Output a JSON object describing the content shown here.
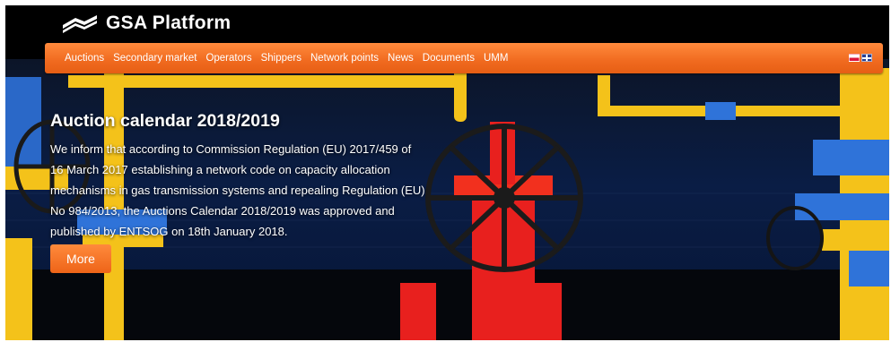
{
  "header": {
    "brand": "GSA Platform"
  },
  "nav": {
    "items": [
      "Auctions",
      "Secondary market",
      "Operators",
      "Shippers",
      "Network points",
      "News",
      "Documents",
      "UMM"
    ]
  },
  "languages": [
    "pl-flag-icon",
    "en-flag-icon"
  ],
  "hero": {
    "title": "Auction calendar 2018/2019",
    "body_lines": [
      "We inform that according to Commission Regulation (EU) 2017/459 of",
      "16 March 2017 establishing a network code on capacity allocation",
      "mechanisms in gas transmission systems and repealing Regulation (EU)",
      "No 984/2013, the Auctions Calendar 2018/2019 was approved and",
      "published by ENTSOG on 18th January 2018."
    ],
    "more_label": "More"
  },
  "colors": {
    "accent": "#f06a1f",
    "header_bg": "#000000",
    "pipe_yellow": "#f4c21a",
    "valve_red": "#e8201e",
    "flange_blue": "#2f73d9"
  }
}
